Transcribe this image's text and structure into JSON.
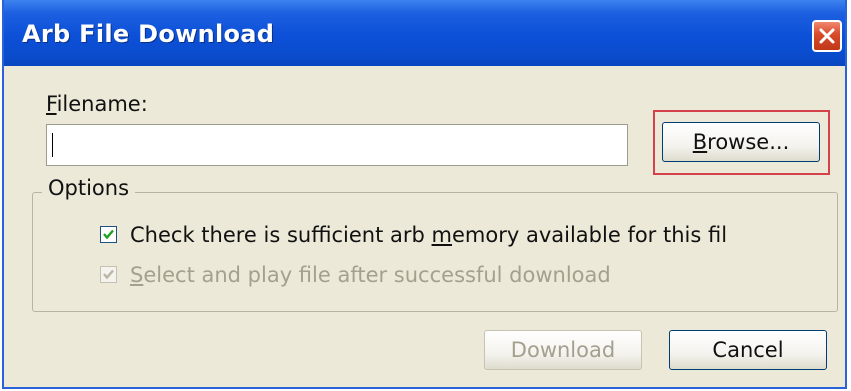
{
  "window": {
    "title": "Arb File Download",
    "close_glyph": "✕"
  },
  "filename": {
    "label_mnemonic": "F",
    "label_rest": "ilename:",
    "value": ""
  },
  "browse_button": {
    "mnemonic": "B",
    "rest": "rowse..."
  },
  "options": {
    "group_label": "Options",
    "items": [
      {
        "pre": "Check there is sufficient arb ",
        "mnemonic": "m",
        "post": "emory available for this file",
        "checked": true,
        "enabled": true
      },
      {
        "pre": "",
        "mnemonic": "S",
        "post": "elect and play file after successful download",
        "checked": true,
        "enabled": false
      }
    ]
  },
  "buttons": {
    "download": "Download",
    "cancel": "Cancel"
  },
  "colors": {
    "titlebar": "#0c50d8",
    "dialog_bg": "#ece9d8",
    "highlight": "#d6424a",
    "disabled_text": "#a3a08e"
  }
}
